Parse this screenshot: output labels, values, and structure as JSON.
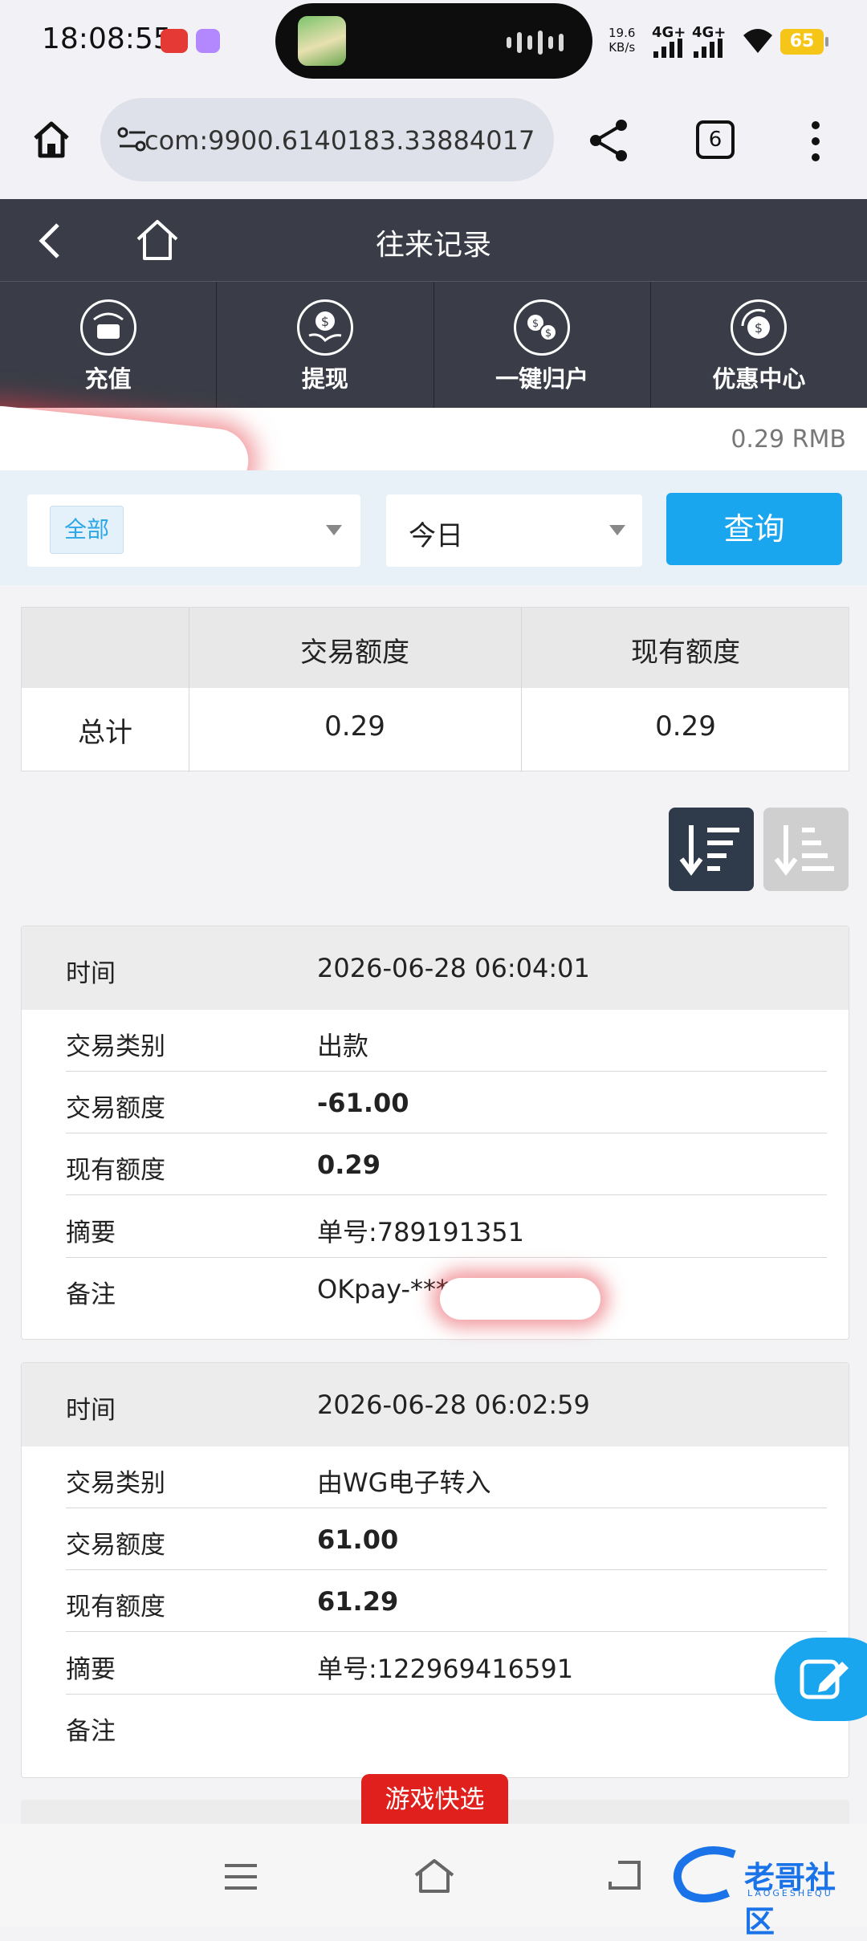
{
  "status_bar": {
    "time": "18:08:55",
    "net_speed_value": "19.6",
    "net_speed_unit": "KB/s",
    "signal1": "4G+",
    "signal2": "4G+",
    "battery": "65"
  },
  "browser": {
    "url": "6140183.33884017.com:9900",
    "tab_count": "6"
  },
  "header": {
    "title": "往来记录"
  },
  "nav": [
    {
      "label": "充值",
      "icon": "deposit-icon"
    },
    {
      "label": "提现",
      "icon": "withdraw-icon"
    },
    {
      "label": "一键归户",
      "icon": "transfer-icon"
    },
    {
      "label": "优惠中心",
      "icon": "promo-icon"
    }
  ],
  "balance": {
    "value": "0.29 RMB"
  },
  "filter": {
    "type_value": "全部",
    "date_value": "今日",
    "query_label": "查询"
  },
  "summary": {
    "col1": "交易额度",
    "col2": "现有额度",
    "row_label": "总计",
    "trade_amount": "0.29",
    "current_amount": "0.29"
  },
  "records": [
    {
      "time_label": "时间",
      "time": "2026-06-28 06:04:01",
      "type_label": "交易类别",
      "type": "出款",
      "amount_label": "交易额度",
      "amount": "-61.00",
      "balance_label": "现有额度",
      "balance": "0.29",
      "summary_label": "摘要",
      "summary": "单号:789191351",
      "remark_label": "备注",
      "remark": "OKpay-***"
    },
    {
      "time_label": "时间",
      "time": "2026-06-28 06:02:59",
      "type_label": "交易类别",
      "type": "由WG电子转入",
      "amount_label": "交易额度",
      "amount": "61.00",
      "balance_label": "现有额度",
      "balance": "61.29",
      "summary_label": "摘要",
      "summary": "单号:122969416591",
      "remark_label": "备注",
      "remark": ""
    }
  ],
  "quick_select": "游戏快选",
  "watermark": {
    "text": "老哥社区",
    "sub": "LAOGESHEQU"
  },
  "colors": {
    "header_bg": "#3a3d47",
    "accent": "#1aa6ef",
    "quick_red": "#e0201c"
  }
}
